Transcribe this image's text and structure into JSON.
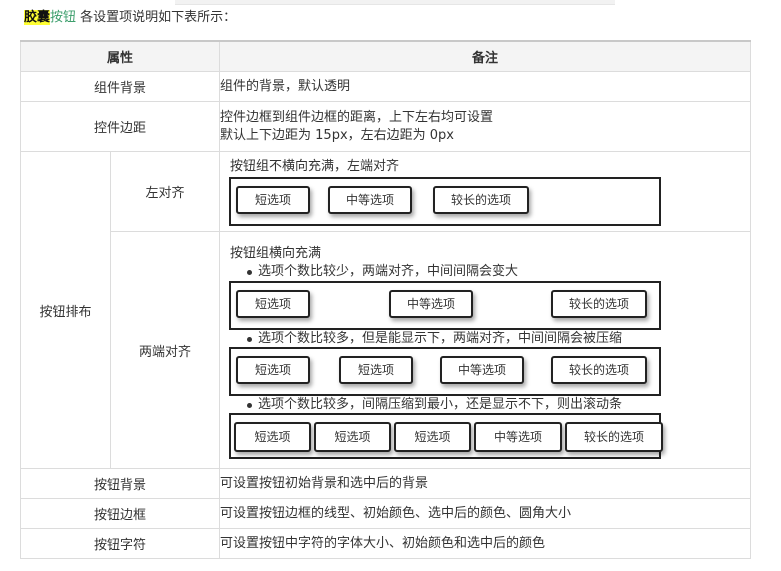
{
  "intro": {
    "name": "胶囊",
    "link": "按钮",
    "text": " 各设置项说明如下表所示："
  },
  "table": {
    "headers": [
      "属性",
      "备注"
    ],
    "row_bg": {
      "prop": "组件背景",
      "note": "组件的背景，默认透明"
    },
    "row_margin": {
      "prop": "控件边距",
      "note_line1": "控件边框到组件边框的距离，上下左右均可设置",
      "note_line2": "默认上下边距为 15px，左右边距为 0px"
    },
    "arrange": {
      "prop": "按钮排布",
      "left": {
        "label": "左对齐",
        "desc": "按钮组不横向充满，左端对齐",
        "buttons": [
          "短选项",
          "中等选项",
          "较长的选项"
        ]
      },
      "justify": {
        "label": "两端对齐",
        "desc": "按钮组横向充满",
        "case1": {
          "text": "选项个数比较少，两端对齐，中间间隔会变大",
          "buttons": [
            "短选项",
            "中等选项",
            "较长的选项"
          ]
        },
        "case2": {
          "text": "选项个数比较多，但是能显示下，两端对齐，中间间隔会被压缩",
          "buttons": [
            "短选项",
            "短选项",
            "中等选项",
            "较长的选项"
          ]
        },
        "case3": {
          "text": "选项个数比较多，间隔压缩到最小，还是显示不下，则出滚动条",
          "buttons": [
            "短选项",
            "短选项",
            "短选项",
            "中等选项",
            "较长的选项"
          ]
        }
      }
    },
    "row_btn_bg": {
      "prop": "按钮背景",
      "note": "可设置按钮初始背景和选中后的背景"
    },
    "row_btn_border": {
      "prop": "按钮边框",
      "note": "可设置按钮边框的线型、初始颜色、选中后的颜色、圆角大小"
    },
    "row_btn_text": {
      "prop": "按钮字符",
      "note": "可设置按钮中字符的字体大小、初始颜色和选中后的颜色"
    }
  }
}
